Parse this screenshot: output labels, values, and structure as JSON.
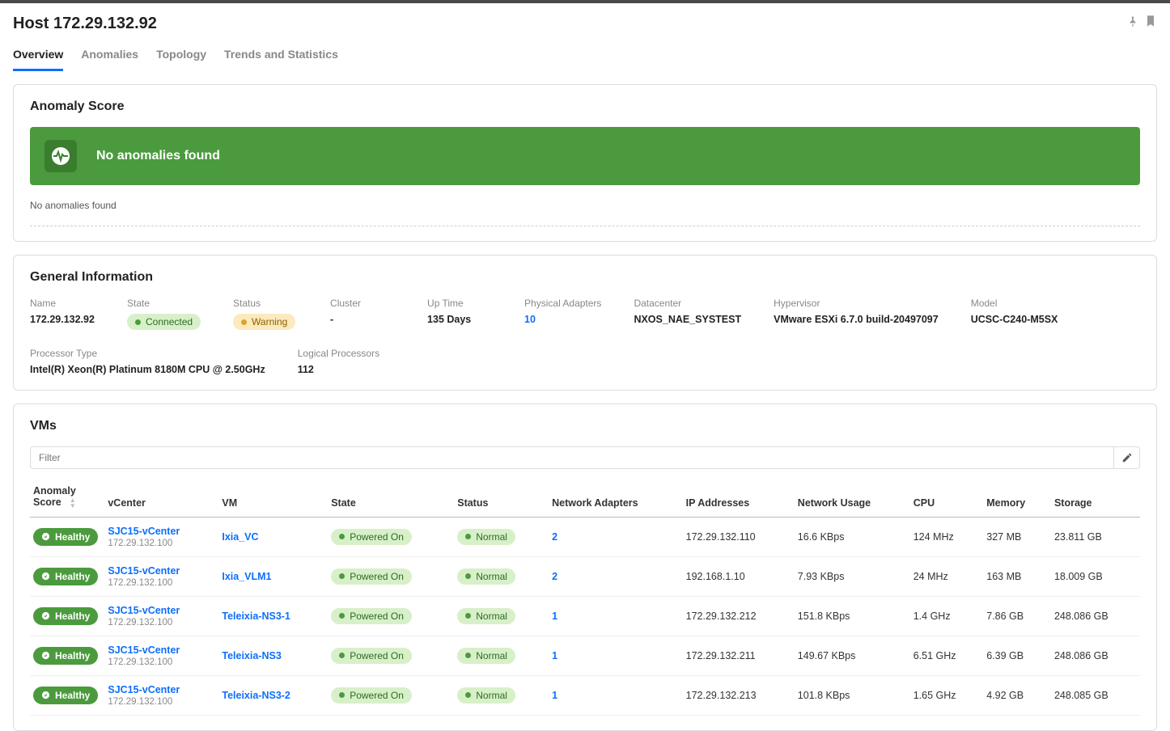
{
  "page_title": "Host 172.29.132.92",
  "tabs": [
    {
      "label": "Overview",
      "active": true
    },
    {
      "label": "Anomalies",
      "active": false
    },
    {
      "label": "Topology",
      "active": false
    },
    {
      "label": "Trends and Statistics",
      "active": false
    }
  ],
  "anomaly_section": {
    "title": "Anomaly Score",
    "banner_text": "No anomalies found",
    "footer_text": "No anomalies found"
  },
  "general_info": {
    "title": "General Information",
    "fields": [
      {
        "label": "Name",
        "value": "172.29.132.92",
        "type": "text"
      },
      {
        "label": "State",
        "value": "Connected",
        "type": "pill-green"
      },
      {
        "label": "Status",
        "value": "Warning",
        "type": "pill-yellow"
      },
      {
        "label": "Cluster",
        "value": "-",
        "type": "text"
      },
      {
        "label": "Up Time",
        "value": "135 Days",
        "type": "text"
      },
      {
        "label": "Physical Adapters",
        "value": "10",
        "type": "link"
      },
      {
        "label": "Datacenter",
        "value": "NXOS_NAE_SYSTEST",
        "type": "text"
      },
      {
        "label": "Hypervisor",
        "value": "VMware ESXi 6.7.0 build-20497097",
        "type": "text"
      },
      {
        "label": "Model",
        "value": "UCSC-C240-M5SX",
        "type": "text"
      },
      {
        "label": "Processor Type",
        "value": "Intel(R) Xeon(R) Platinum 8180M CPU @ 2.50GHz",
        "type": "text"
      },
      {
        "label": "Logical Processors",
        "value": "112",
        "type": "text"
      }
    ]
  },
  "vms_section": {
    "title": "VMs",
    "filter_placeholder": "Filter",
    "columns": [
      "Anomaly Score",
      "vCenter",
      "VM",
      "State",
      "Status",
      "Network Adapters",
      "IP Addresses",
      "Network Usage",
      "CPU",
      "Memory",
      "Storage"
    ],
    "rows": [
      {
        "anomaly": "Healthy",
        "vcenter_name": "SJC15-vCenter",
        "vcenter_ip": "172.29.132.100",
        "vm": "Ixia_VC",
        "state": "Powered On",
        "status": "Normal",
        "adapters": "2",
        "ip": "172.29.132.110",
        "net_usage": "16.6 KBps",
        "cpu": "124 MHz",
        "memory": "327 MB",
        "storage": "23.811 GB"
      },
      {
        "anomaly": "Healthy",
        "vcenter_name": "SJC15-vCenter",
        "vcenter_ip": "172.29.132.100",
        "vm": "Ixia_VLM1",
        "state": "Powered On",
        "status": "Normal",
        "adapters": "2",
        "ip": "192.168.1.10",
        "net_usage": "7.93 KBps",
        "cpu": "24 MHz",
        "memory": "163 MB",
        "storage": "18.009 GB"
      },
      {
        "anomaly": "Healthy",
        "vcenter_name": "SJC15-vCenter",
        "vcenter_ip": "172.29.132.100",
        "vm": "Teleixia-NS3-1",
        "state": "Powered On",
        "status": "Normal",
        "adapters": "1",
        "ip": "172.29.132.212",
        "net_usage": "151.8 KBps",
        "cpu": "1.4 GHz",
        "memory": "7.86 GB",
        "storage": "248.086 GB"
      },
      {
        "anomaly": "Healthy",
        "vcenter_name": "SJC15-vCenter",
        "vcenter_ip": "172.29.132.100",
        "vm": "Teleixia-NS3",
        "state": "Powered On",
        "status": "Normal",
        "adapters": "1",
        "ip": "172.29.132.211",
        "net_usage": "149.67 KBps",
        "cpu": "6.51 GHz",
        "memory": "6.39 GB",
        "storage": "248.086 GB"
      },
      {
        "anomaly": "Healthy",
        "vcenter_name": "SJC15-vCenter",
        "vcenter_ip": "172.29.132.100",
        "vm": "Teleixia-NS3-2",
        "state": "Powered On",
        "status": "Normal",
        "adapters": "1",
        "ip": "172.29.132.213",
        "net_usage": "101.8 KBps",
        "cpu": "1.65 GHz",
        "memory": "4.92 GB",
        "storage": "248.085 GB"
      }
    ]
  }
}
